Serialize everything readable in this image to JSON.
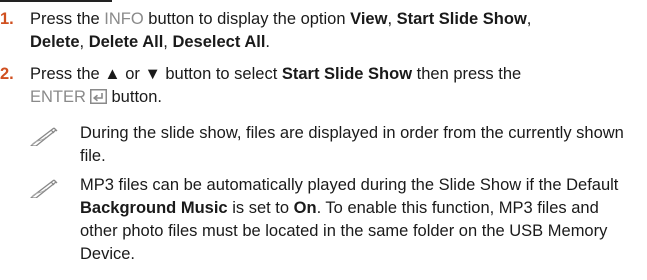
{
  "steps": [
    {
      "number": "1.",
      "parts": {
        "p1": "Press the ",
        "info": "INFO",
        "p2": " button to display the option ",
        "view": "View",
        "c1": ", ",
        "start": "Start Slide Show",
        "c2": ",",
        "delete": "Delete",
        "c3": ", ",
        "delete_all": "Delete All",
        "c4": ", ",
        "deselect_all": "Deselect All",
        "end": "."
      }
    },
    {
      "number": "2.",
      "parts": {
        "p1": "Press the ▲ or ▼ button to select ",
        "start": "Start Slide Show",
        "p2": " then press the",
        "enter": "ENTER",
        "p3": " button."
      }
    }
  ],
  "notes": [
    {
      "text": "During the slide show, files are displayed in order from the currently shown file."
    },
    {
      "p1": "MP3 files can be automatically played during the Slide Show if the Default ",
      "bg_music": "Background Music",
      "p2": " is set to ",
      "on": "On",
      "p3": ". To enable this function, MP3 files and other photo files must be located in the same folder on the USB Memory Device."
    }
  ],
  "icons": {
    "note": "note-pencil-icon",
    "enter": "enter-key-icon"
  },
  "colors": {
    "step_number": "#d05020",
    "key_text": "#8a8a8a"
  }
}
